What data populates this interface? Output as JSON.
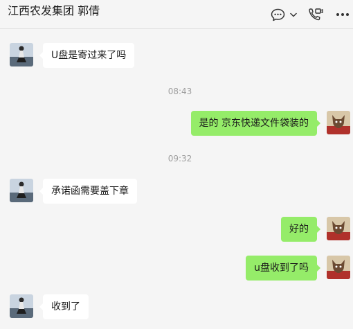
{
  "header": {
    "title": "江西农发集团 郭倩",
    "icons": [
      "chat-bubble-icon",
      "chevron-down-icon",
      "video-call-icon",
      "more-icon"
    ]
  },
  "colors": {
    "background": "#f5f5f5",
    "incoming_bubble": "#ffffff",
    "outgoing_bubble": "#95ec69",
    "timestamp": "#9e9e9e"
  },
  "messages": [
    {
      "side": "in",
      "text": "U盘是寄过来了吗"
    },
    {
      "timestamp": "08:43"
    },
    {
      "side": "out",
      "text": "是的 京东快递文件袋装的"
    },
    {
      "timestamp": "09:32"
    },
    {
      "side": "in",
      "text": "承诺函需要盖下章"
    },
    {
      "side": "out",
      "text": "好的"
    },
    {
      "side": "out",
      "text": "u盘收到了吗"
    },
    {
      "side": "in",
      "text": "收到了"
    }
  ]
}
